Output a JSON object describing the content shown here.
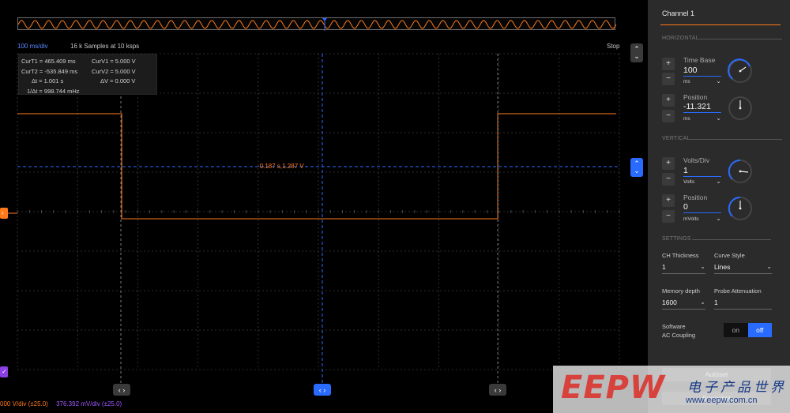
{
  "header": {
    "time_per_div": "100 ms/div",
    "samples": "16 k Samples at 10 ksps",
    "status": "Stop"
  },
  "measurements": {
    "curT1": "CurT1 = 465.409 ms",
    "curT2": "CurT2 = -535.849 ms",
    "deltaT": "Δt = 1.001 s",
    "inv_deltaT": "1/Δt = 998.744 mHz",
    "curV1": "CurV1 = 5.000 V",
    "curV2": "CurV2 = 5.000 V",
    "deltaV": "ΔV =  0.000 V"
  },
  "cursor_readout": "-0.187 s,1.287 V",
  "footer": {
    "ch1_scale": "000 V/div (±25.0)",
    "ch2_scale": "376.392 mV/div (±25.0)"
  },
  "colors": {
    "ch1": "#ff7a1a",
    "ch2": "#8a3fe6",
    "accent": "#2a6bff",
    "grid": "#3c3c3c"
  },
  "icons": {
    "cursor_pair": "chevron-left-right-icon",
    "edge_pair": "chevron-up-down-icon",
    "level_marker": "chevron-right-icon",
    "ch2_marker": "check-icon"
  },
  "panel": {
    "title": "Channel 1",
    "horizontal_section": "HORIZONTAL",
    "vertical_section": "VERTICAL",
    "settings_section": "SETTINGS",
    "time_base": {
      "label": "Time Base",
      "value": "100",
      "unit": "ms"
    },
    "h_position": {
      "label": "Position",
      "value": "-11.321",
      "unit": "ms"
    },
    "volts_div": {
      "label": "Volts/Div",
      "value": "1",
      "unit": "Volts"
    },
    "v_position": {
      "label": "Position",
      "value": "0",
      "unit": "mVolts"
    },
    "plus": "+",
    "minus": "−",
    "ch_thickness": {
      "label": "CH Thickness",
      "value": "1"
    },
    "curve_style": {
      "label": "Curve Style",
      "value": "Lines"
    },
    "memory_depth": {
      "label": "Memory depth",
      "value": "1600"
    },
    "probe_attenuation": {
      "label": "Probe Attenuation",
      "value": "1"
    },
    "software_ac": {
      "label_line1": "Software",
      "label_line2": "AC Coupling",
      "on": "on",
      "off": "off",
      "selected": "off"
    },
    "autoset": "Autoset",
    "snapshot": "Snapshot"
  },
  "watermark": {
    "logo": "EEPW",
    "cn": "电子产品世界",
    "url": "www.eepw.com.cn"
  }
}
